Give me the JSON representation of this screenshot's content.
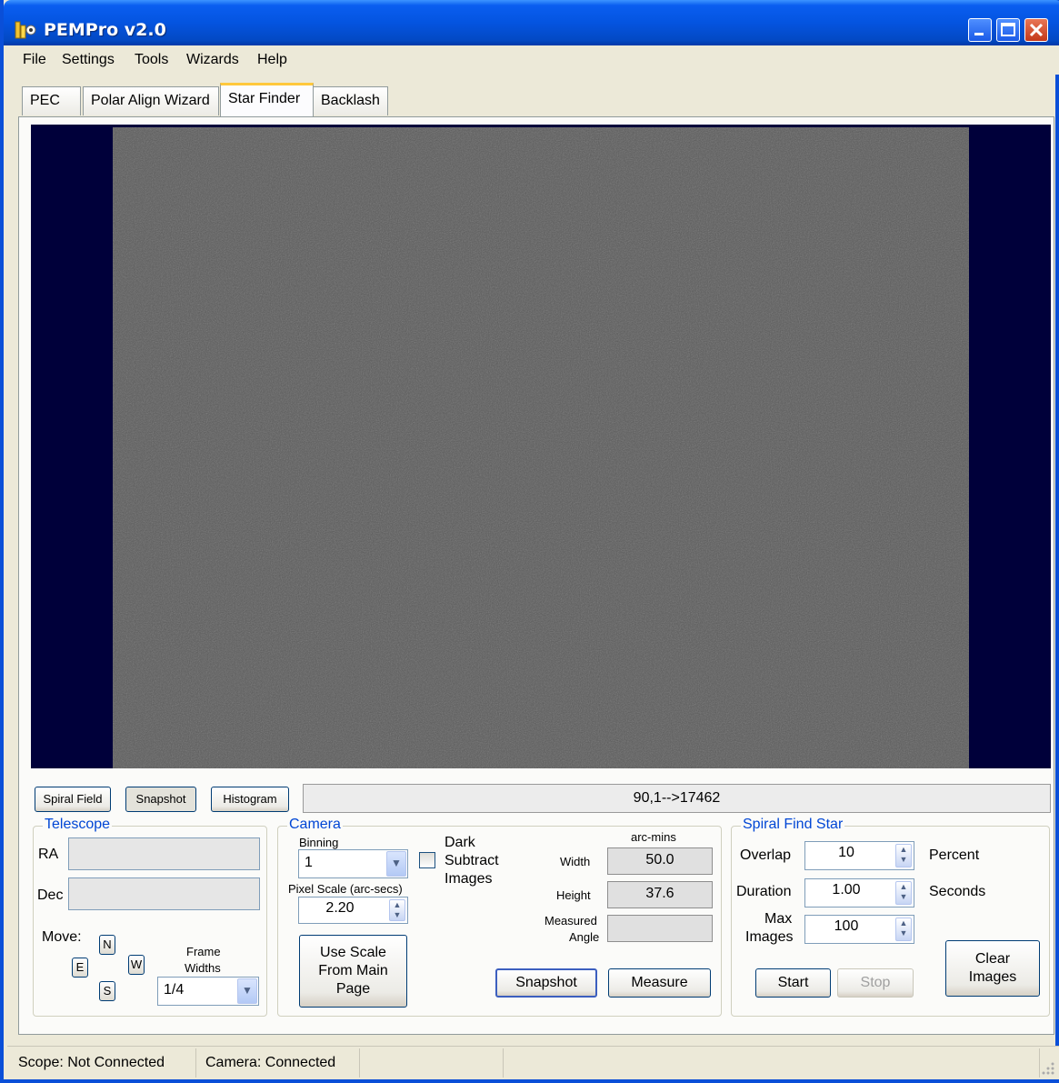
{
  "window": {
    "title": "PEMPro v2.0"
  },
  "menu": [
    "File",
    "Settings",
    "Tools",
    "Wizards",
    "Help"
  ],
  "tabs": [
    "PEC",
    "Polar Align Wizard",
    "Star Finder",
    "Backlash"
  ],
  "active_tab": "Star Finder",
  "toolbar": {
    "spiral_field": "Spiral Field",
    "snapshot": "Snapshot",
    "histogram": "Histogram",
    "readout": "90,1-->17462"
  },
  "telescope": {
    "title": "Telescope",
    "ra_label": "RA",
    "ra_value": "",
    "dec_label": "Dec",
    "dec_value": "",
    "move_label": "Move:",
    "n": "N",
    "e": "E",
    "w": "W",
    "s": "S",
    "frame_widths_line1": "Frame",
    "frame_widths_line2": "Widths",
    "frame_widths_value": "1/4"
  },
  "camera": {
    "title": "Camera",
    "binning_label": "Binning",
    "binning_value": "1",
    "dark_line1": "Dark",
    "dark_line2": "Subtract",
    "dark_line3": "Images",
    "dark_checked": false,
    "pixel_scale_label": "Pixel Scale (arc-secs)",
    "pixel_scale_value": "2.20",
    "use_scale_line1": "Use Scale",
    "use_scale_line2": "From Main",
    "use_scale_line3": "Page",
    "arc_mins_label": "arc-mins",
    "width_label": "Width",
    "width_value": "50.0",
    "height_label": "Height",
    "height_value": "37.6",
    "measured_line1": "Measured",
    "measured_line2": "Angle",
    "measured_value": "",
    "snapshot": "Snapshot",
    "measure": "Measure"
  },
  "spiral": {
    "title": "Spiral Find Star",
    "overlap_label": "Overlap",
    "overlap_value": "10",
    "overlap_unit": "Percent",
    "duration_label": "Duration",
    "duration_value": "1.00",
    "duration_unit": "Seconds",
    "max_line1": "Max",
    "max_line2": "Images",
    "max_value": "100",
    "start": "Start",
    "stop": "Stop",
    "clear_line1": "Clear",
    "clear_line2": "Images"
  },
  "status": {
    "scope": "Scope: Not Connected",
    "camera": "Camera: Connected"
  },
  "colors": {
    "titlebar": "#0454e0",
    "image_background": "#00003a",
    "image_frame": "#555555",
    "group_title": "#0046d5"
  }
}
